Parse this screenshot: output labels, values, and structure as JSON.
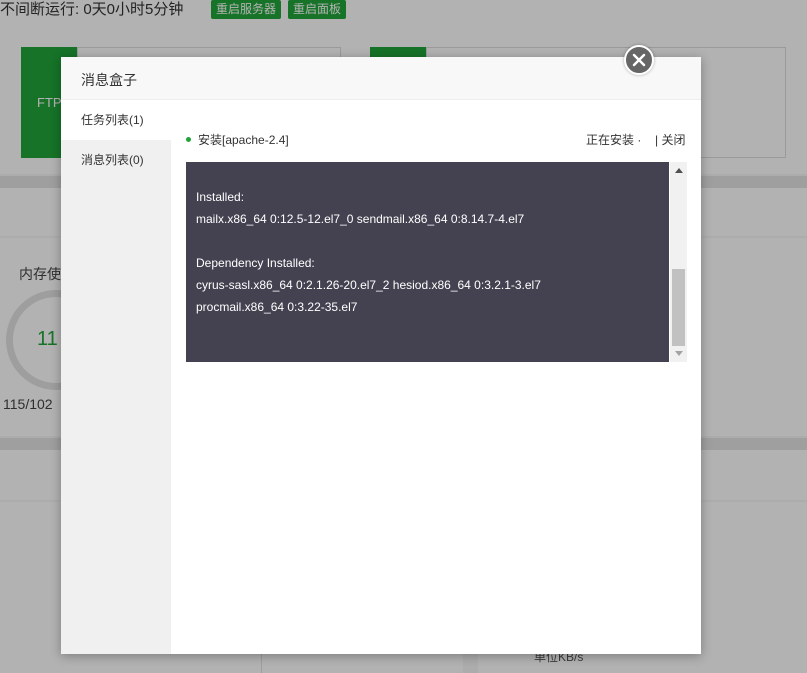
{
  "background": {
    "uptime": "不间断运行: 0天0小时5分钟",
    "restart_server_label": "重启服务器",
    "restart_panel_label": "重启面板",
    "ftp_label": "FTP",
    "memory_title": "内存使",
    "memory_percent": "11",
    "memory_detail": "115/102",
    "speed_unit": "单位KB/s"
  },
  "modal": {
    "title": "消息盒子",
    "close_icon": "close-icon",
    "sidebar": [
      {
        "label": "任务列表(1)",
        "active": true
      },
      {
        "label": "消息列表(0)",
        "active": false
      }
    ],
    "task": {
      "name": "安装[apache-2.4]",
      "status": "正在安装 ·",
      "close_label": "| 关闭"
    },
    "console_lines": [
      "Installed:",
      "mailx.x86_64 0:12.5-12.el7_0 sendmail.x86_64 0:8.14.7-4.el7",
      "",
      "Dependency Installed:",
      "cyrus-sasl.x86_64 0:2.1.26-20.el7_2 hesiod.x86_64 0:3.2.1-3.el7",
      "procmail.x86_64 0:3.22-35.el7"
    ]
  },
  "colors": {
    "accent": "#20a53a",
    "console_bg": "#444250",
    "overlay": "rgba(0,0,0,0.3)"
  }
}
